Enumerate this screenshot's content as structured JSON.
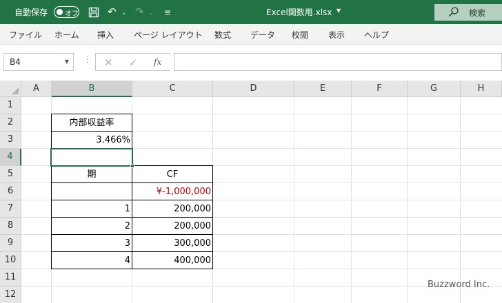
{
  "titlebar": {
    "autosave_label": "自動保存",
    "autosave_state": "オフ",
    "filename": "Excel関数用.xlsx",
    "search_label": "検索"
  },
  "ribbon": {
    "tabs": [
      "ファイル",
      "ホーム",
      "挿入",
      "ページ レイアウト",
      "数式",
      "データ",
      "校閲",
      "表示",
      "ヘルプ"
    ]
  },
  "formula_bar": {
    "name_box": "B4",
    "fx_label": "fx",
    "formula": ""
  },
  "sheet": {
    "columns": [
      "A",
      "B",
      "C",
      "D",
      "E",
      "F",
      "G",
      "H"
    ],
    "rows": [
      "1",
      "2",
      "3",
      "4",
      "5",
      "6",
      "7",
      "8",
      "9",
      "10",
      "11",
      "12"
    ],
    "selected_column": "B",
    "selected_row": "4",
    "cells": {
      "B2": "内部収益率",
      "B3": "3.466%",
      "B5": "期",
      "C5": "CF",
      "C6": "¥-1,000,000",
      "B7": "1",
      "C7": "200,000",
      "B8": "2",
      "C8": "200,000",
      "B9": "3",
      "C9": "300,000",
      "B10": "4",
      "C10": "400,000"
    },
    "negative_color": "#c00000",
    "accent_color": "#217346"
  },
  "watermark": "Buzzword Inc."
}
